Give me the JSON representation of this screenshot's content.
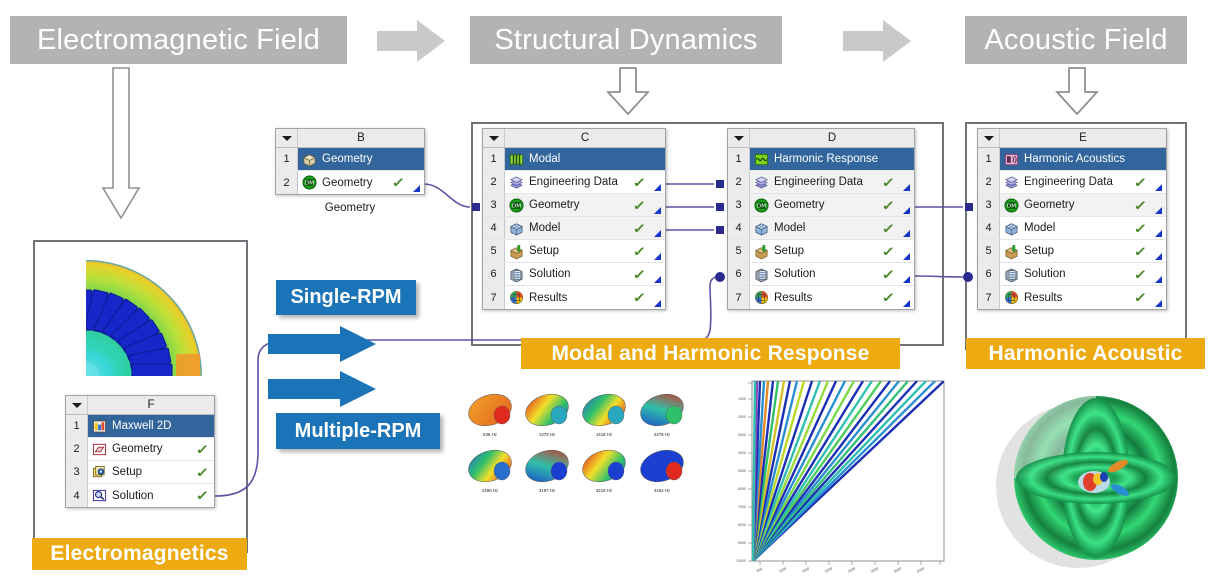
{
  "banners": [
    {
      "id": "electromagnetic-field",
      "label": "Electromagnetic Field"
    },
    {
      "id": "structural-dynamics",
      "label": "Structural Dynamics"
    },
    {
      "id": "acoustic-field",
      "label": "Acoustic Field"
    }
  ],
  "systems": {
    "b": {
      "letter": "B",
      "caption": "Geometry",
      "rows": [
        {
          "n": "1",
          "label": "Geometry",
          "icon": "geometry-box-icon",
          "selected": true,
          "check": false,
          "triangle": false
        },
        {
          "n": "2",
          "label": "Geometry",
          "icon": "designmodeler-icon",
          "selected": false,
          "check": true,
          "triangle": true
        }
      ]
    },
    "c": {
      "letter": "C",
      "caption": "",
      "rows": [
        {
          "n": "1",
          "label": "Modal",
          "icon": "modal-icon",
          "selected": true,
          "check": false,
          "triangle": false
        },
        {
          "n": "2",
          "label": "Engineering Data",
          "icon": "engineering-data-icon",
          "selected": false,
          "check": true,
          "triangle": true
        },
        {
          "n": "3",
          "label": "Geometry",
          "icon": "designmodeler-icon",
          "selected": false,
          "check": true,
          "triangle": true,
          "shaded": true
        },
        {
          "n": "4",
          "label": "Model",
          "icon": "model-icon",
          "selected": false,
          "check": true,
          "triangle": true,
          "shaded": true
        },
        {
          "n": "5",
          "label": "Setup",
          "icon": "setup-icon",
          "selected": false,
          "check": true,
          "triangle": true
        },
        {
          "n": "6",
          "label": "Solution",
          "icon": "solution-icon",
          "selected": false,
          "check": true,
          "triangle": true
        },
        {
          "n": "7",
          "label": "Results",
          "icon": "results-icon",
          "selected": false,
          "check": true,
          "triangle": true
        }
      ]
    },
    "d": {
      "letter": "D",
      "caption": "",
      "rows": [
        {
          "n": "1",
          "label": "Harmonic Response",
          "icon": "harmonic-response-icon",
          "selected": true,
          "check": false,
          "triangle": false
        },
        {
          "n": "2",
          "label": "Engineering Data",
          "icon": "engineering-data-icon",
          "selected": false,
          "check": true,
          "triangle": true,
          "shaded": true
        },
        {
          "n": "3",
          "label": "Geometry",
          "icon": "designmodeler-icon",
          "selected": false,
          "check": true,
          "triangle": true,
          "shaded": true
        },
        {
          "n": "4",
          "label": "Model",
          "icon": "model-icon",
          "selected": false,
          "check": true,
          "triangle": true,
          "shaded": true
        },
        {
          "n": "5",
          "label": "Setup",
          "icon": "setup-icon",
          "selected": false,
          "check": true,
          "triangle": true
        },
        {
          "n": "6",
          "label": "Solution",
          "icon": "solution-icon",
          "selected": false,
          "check": true,
          "triangle": true
        },
        {
          "n": "7",
          "label": "Results",
          "icon": "results-icon",
          "selected": false,
          "check": true,
          "triangle": true
        }
      ]
    },
    "e": {
      "letter": "E",
      "caption": "",
      "rows": [
        {
          "n": "1",
          "label": "Harmonic Acoustics",
          "icon": "harmonic-acoustics-icon",
          "selected": true,
          "check": false,
          "triangle": false
        },
        {
          "n": "2",
          "label": "Engineering Data",
          "icon": "engineering-data-icon",
          "selected": false,
          "check": true,
          "triangle": true
        },
        {
          "n": "3",
          "label": "Geometry",
          "icon": "designmodeler-icon",
          "selected": false,
          "check": true,
          "triangle": true,
          "shaded": true
        },
        {
          "n": "4",
          "label": "Model",
          "icon": "model-icon",
          "selected": false,
          "check": true,
          "triangle": true
        },
        {
          "n": "5",
          "label": "Setup",
          "icon": "setup-icon",
          "selected": false,
          "check": true,
          "triangle": true
        },
        {
          "n": "6",
          "label": "Solution",
          "icon": "solution-icon",
          "selected": false,
          "check": true,
          "triangle": true
        },
        {
          "n": "7",
          "label": "Results",
          "icon": "results-icon",
          "selected": false,
          "check": true,
          "triangle": true
        }
      ]
    },
    "f": {
      "letter": "F",
      "caption": "",
      "rows": [
        {
          "n": "1",
          "label": "Maxwell 2D",
          "icon": "maxwell2d-icon",
          "selected": true,
          "check": false,
          "triangle": false
        },
        {
          "n": "2",
          "label": "Geometry",
          "icon": "maxwell-geometry-icon",
          "selected": false,
          "check": true,
          "triangle": false
        },
        {
          "n": "3",
          "label": "Setup",
          "icon": "maxwell-setup-icon",
          "selected": false,
          "check": true,
          "triangle": false
        },
        {
          "n": "4",
          "label": "Solution",
          "icon": "maxwell-solution-icon",
          "selected": false,
          "check": true,
          "triangle": false
        }
      ]
    }
  },
  "yellow_labels": [
    {
      "id": "electromagnetics",
      "label": "Electromagnetics"
    },
    {
      "id": "modal-and-harmonic-response",
      "label": "Modal and Harmonic Response"
    },
    {
      "id": "harmonic-acoustic",
      "label": "Harmonic Acoustic"
    }
  ],
  "blue_labels": [
    {
      "id": "single-rpm",
      "label": "Single-RPM"
    },
    {
      "id": "multiple-rpm",
      "label": "Multiple-RPM"
    }
  ],
  "mode_shapes": {
    "row1": [
      "538 Hz",
      "1379 Hz",
      "1418 Hz",
      "2478 Hz"
    ],
    "row2": [
      "2490 Hz",
      "3187 Hz",
      "3219 Hz",
      "4452 Hz"
    ]
  },
  "colors": {
    "banner_grey": "#b3b3b3",
    "yellow": "#eeaa11",
    "blue": "#1b73b8",
    "selected_row": "#31659c",
    "check_green": "#4f8a2e",
    "connector_purple": "#5b55a5",
    "group_outline": "#6f7276"
  }
}
